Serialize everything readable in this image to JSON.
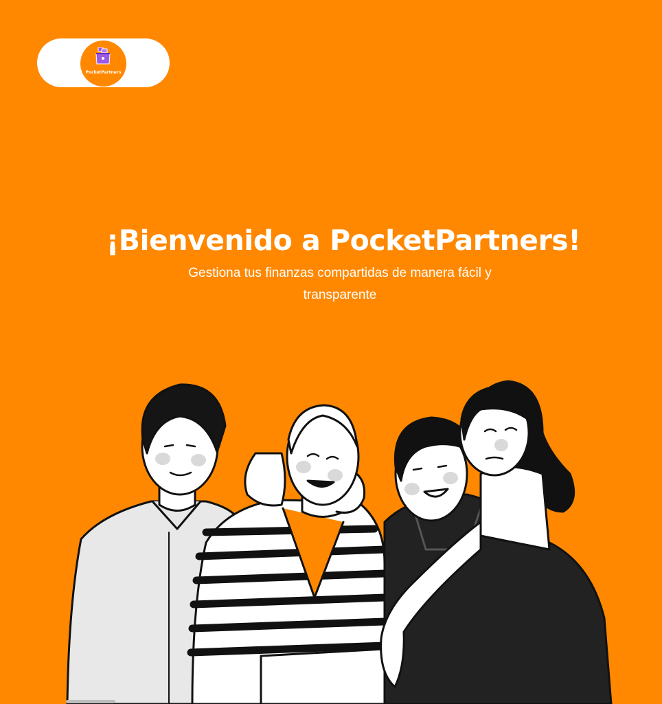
{
  "logo": {
    "text": "PocketPartners",
    "icon": "wallet-icon"
  },
  "welcome": {
    "title": "¡Bienvenido a PocketPartners!",
    "subtitle": "Gestiona tus finanzas compartidas de manera fácil y transparente"
  },
  "illustration": {
    "icon": "group-of-friends-illustration"
  },
  "colors": {
    "background": "#FF8800",
    "logo_accent": "#9B59E6",
    "text": "#FFFFFF"
  }
}
